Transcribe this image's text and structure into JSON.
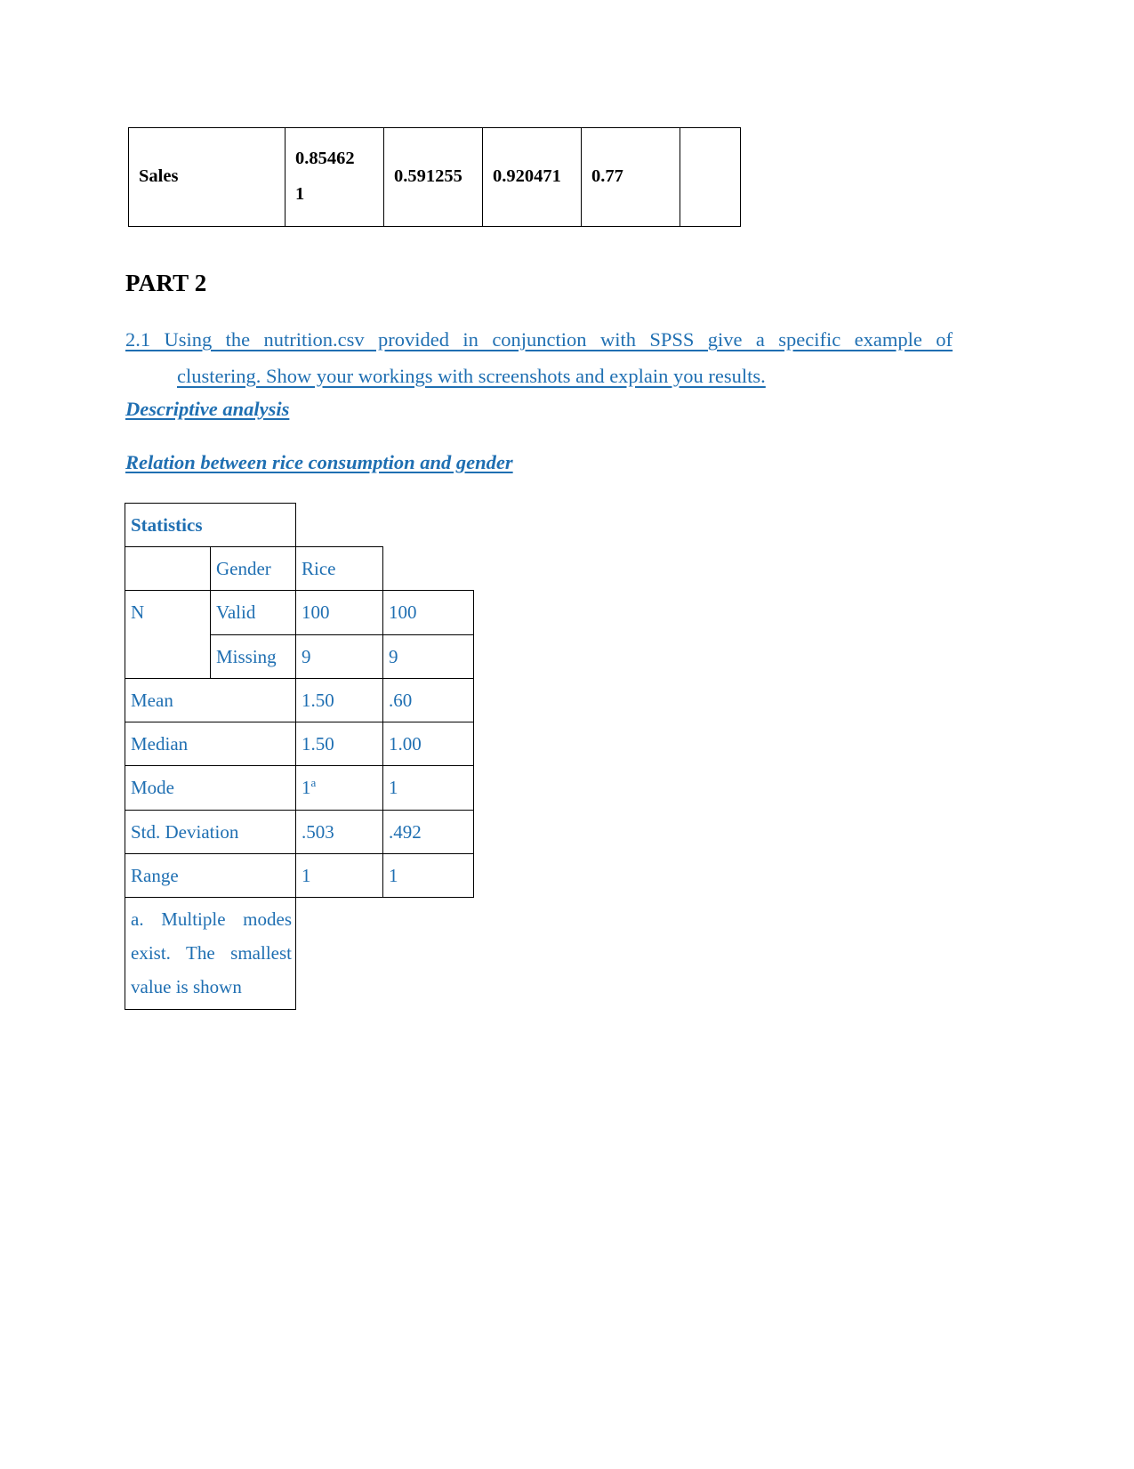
{
  "document": {
    "accent_color": "#1F6FB2",
    "text_color": "#000000"
  },
  "top_table": {
    "name": "correlation-table-fragment",
    "row_label": "Sales",
    "values": [
      "0.854621",
      "0.591255",
      "0.920471",
      "0.77",
      ""
    ],
    "value_line1": "0.85462",
    "value_line2": "1"
  },
  "headings": {
    "part": "PART 2",
    "descriptive": "Descriptive analysis",
    "relation": "Relation between rice consumption and gender"
  },
  "question": {
    "line1": "2.1 Using the nutrition.csv provided in conjunction with SPSS give a specific example of",
    "line2": "clustering. Show your workings with screenshots and explain you results."
  },
  "stats_table": {
    "title": "Statistics",
    "columns": [
      "",
      "Gender",
      "Rice"
    ],
    "rows": [
      {
        "label": "N",
        "sublabel": "Valid",
        "gender": "100",
        "rice": "100"
      },
      {
        "label": "",
        "sublabel": "Missing",
        "gender": "9",
        "rice": "9"
      },
      {
        "label": "Mean",
        "sublabel": "",
        "gender": "1.50",
        "rice": ".60"
      },
      {
        "label": "Median",
        "sublabel": "",
        "gender": "1.50",
        "rice": "1.00"
      },
      {
        "label": "Mode",
        "sublabel": "",
        "gender": "1",
        "gender_superscript": "a",
        "rice": "1"
      },
      {
        "label": "Std. Deviation",
        "sublabel": "",
        "gender": ".503",
        "rice": ".492"
      },
      {
        "label": "Range",
        "sublabel": "",
        "gender": "1",
        "rice": "1"
      }
    ],
    "footnote": "a. Multiple modes exist. The smallest value is shown"
  }
}
